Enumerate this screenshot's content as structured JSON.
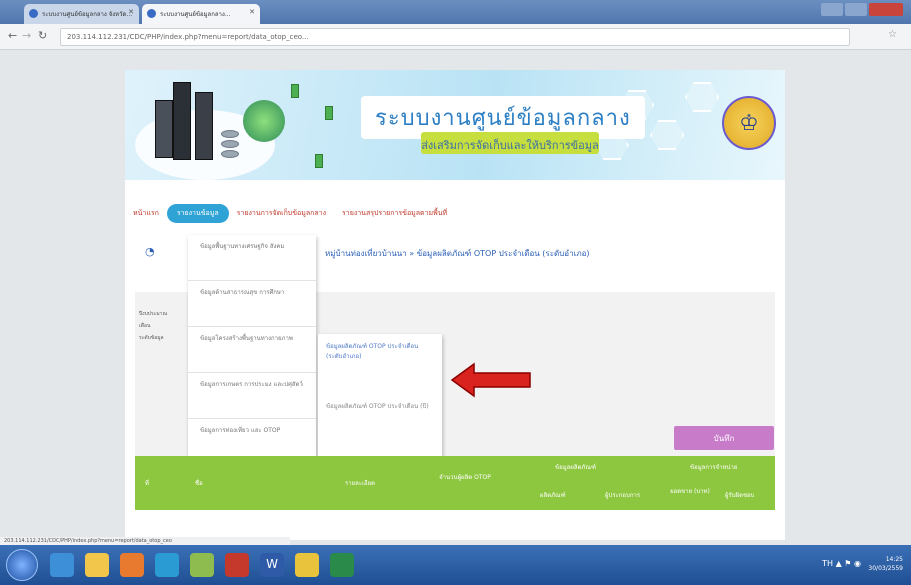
{
  "browser": {
    "tabs": [
      {
        "label": "ระบบงานศูนย์ข้อมูลกลาง จังหวัด..."
      },
      {
        "label": "ระบบงานศูนย์ข้อมูลกลาง..."
      }
    ],
    "address": "203.114.112.231/CDC/PHP/index.php?menu=report/data_otop_ceo..."
  },
  "banner": {
    "title": "ระบบงานศูนย์ข้อมูลกลาง",
    "subtitle": "ส่งเสริมการจัดเก็บและให้บริการข้อมูล",
    "emblem": "crest-icon"
  },
  "menu": {
    "home": "หน้าแรก",
    "active": "รายงานข้อมูล",
    "item3": "รายงานการจัดเก็บข้อมูลกลาง",
    "item4": "รายงานสรุปรายการข้อมูลตามพื้นที่"
  },
  "breadcrumb": "หมู่บ้านท่องเที่ยวบ้านนา » ข้อมูลผลิตภัณฑ์ OTOP ประจำเดือน (ระดับอำเภอ)",
  "side_labels": [
    "ปีงบประมาณ",
    "เดือน",
    "ระดับข้อมูล"
  ],
  "dropdown1": [
    "ข้อมูลพื้นฐานทางเศรษฐกิจ สังคม",
    "ข้อมูลด้านสาธารณสุข การศึกษา",
    "ข้อมูลโครงสร้างพื้นฐานทางกายภาพ",
    "ข้อมูลการเกษตร การประมง และปศุสัตว์",
    "ข้อมูลการท่องเที่ยว และ OTOP"
  ],
  "dropdown2": [
    "ข้อมูลผลิตภัณฑ์ OTOP ประจำเดือน (ระดับอำเภอ)",
    "ข้อมูลผลิตภัณฑ์ OTOP ประจำเดือน (ปี)"
  ],
  "save_label": "บันทึก",
  "table_headers": {
    "h1": "ที่",
    "h2": "ชื่อ",
    "h3": "รายละเอียด",
    "h4": "จำนวนผู้ผลิต OTOP",
    "group1": "ข้อมูลผลิตภัณฑ์",
    "group2": "ข้อมูลการจำหน่าย",
    "s1": "ผลิตภัณฑ์",
    "s2": "ผู้ประกอบการ",
    "s3": "ยอดขาย (บาท)",
    "s4": "ผู้รับผิดชอบ"
  },
  "status_url": "203.114.112.231/CDC/PHP/index.php?menu=report/data_otop_ceo",
  "taskbar": {
    "time": "14:25",
    "date": "30/03/2559",
    "lang": "TH"
  },
  "colors": {
    "accent": "#2fa3d6",
    "menu_text": "#c03a2b",
    "table_header": "#8dc63f",
    "save_button": "#c77bc9",
    "arrow": "#d9231f"
  }
}
